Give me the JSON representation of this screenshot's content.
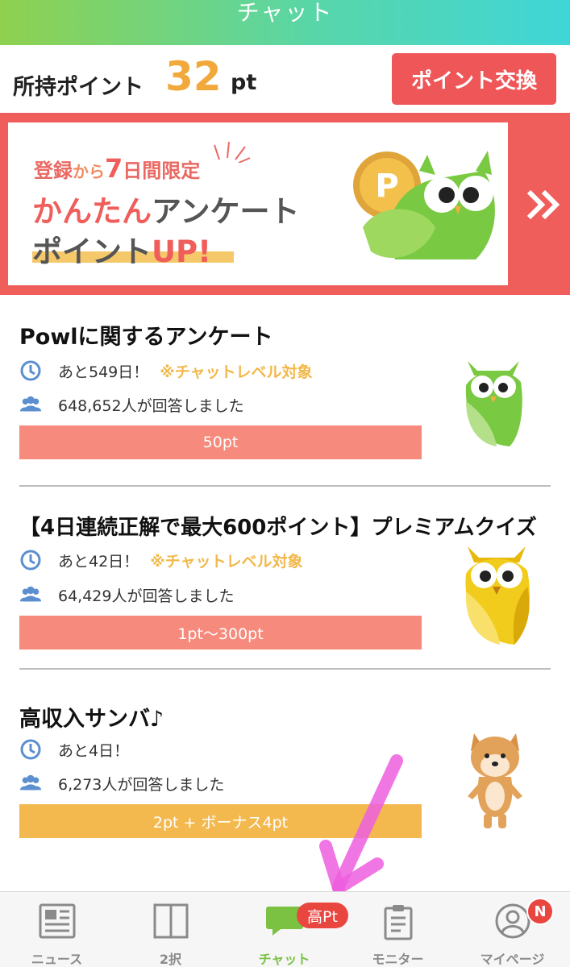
{
  "header": {
    "title": "チャット"
  },
  "points": {
    "label": "所持ポイント",
    "value": "32",
    "unit": "pt",
    "exchange_button": "ポイント交換"
  },
  "banner": {
    "line1_a": "登録",
    "line1_b": "から",
    "line1_c": "7",
    "line1_d": "日間限定",
    "line2_a": "かんたん",
    "line2_b": "アンケート",
    "line3_a": "ポイント",
    "line3_b": "UP",
    "line3_c": "!",
    "coin_letter": "P"
  },
  "cards": [
    {
      "title": "Powlに関するアンケート",
      "deadline": "あと549日！",
      "note": "※チャットレベル対象",
      "respondents": "648,652人が回答しました",
      "button": "50pt"
    },
    {
      "title": "【4日連続正解で最大600ポイント】プレミアムクイズ",
      "deadline": "あと42日！",
      "note": "※チャットレベル対象",
      "respondents": "64,429人が回答しました",
      "button": "1pt〜300pt"
    },
    {
      "title": "高収入サンバ♪",
      "deadline": "あと4日！",
      "note": "",
      "respondents": "6,273人が回答しました",
      "button": "2pt + ボーナス4pt"
    }
  ],
  "nav": {
    "items": [
      {
        "label": "ニュース",
        "icon": "news-icon"
      },
      {
        "label": "2択",
        "icon": "two-choice-icon"
      },
      {
        "label": "チャット",
        "icon": "chat-icon"
      },
      {
        "label": "モニター",
        "icon": "clipboard-icon"
      },
      {
        "label": "マイページ",
        "icon": "user-icon"
      }
    ],
    "chat_badge": "高Pt",
    "mypage_badge": "N"
  },
  "colors": {
    "accent_red": "#ef5658",
    "accent_green": "#7bc142",
    "points_orange": "#f2a93b",
    "annotation_pink": "#ee5fe0"
  }
}
